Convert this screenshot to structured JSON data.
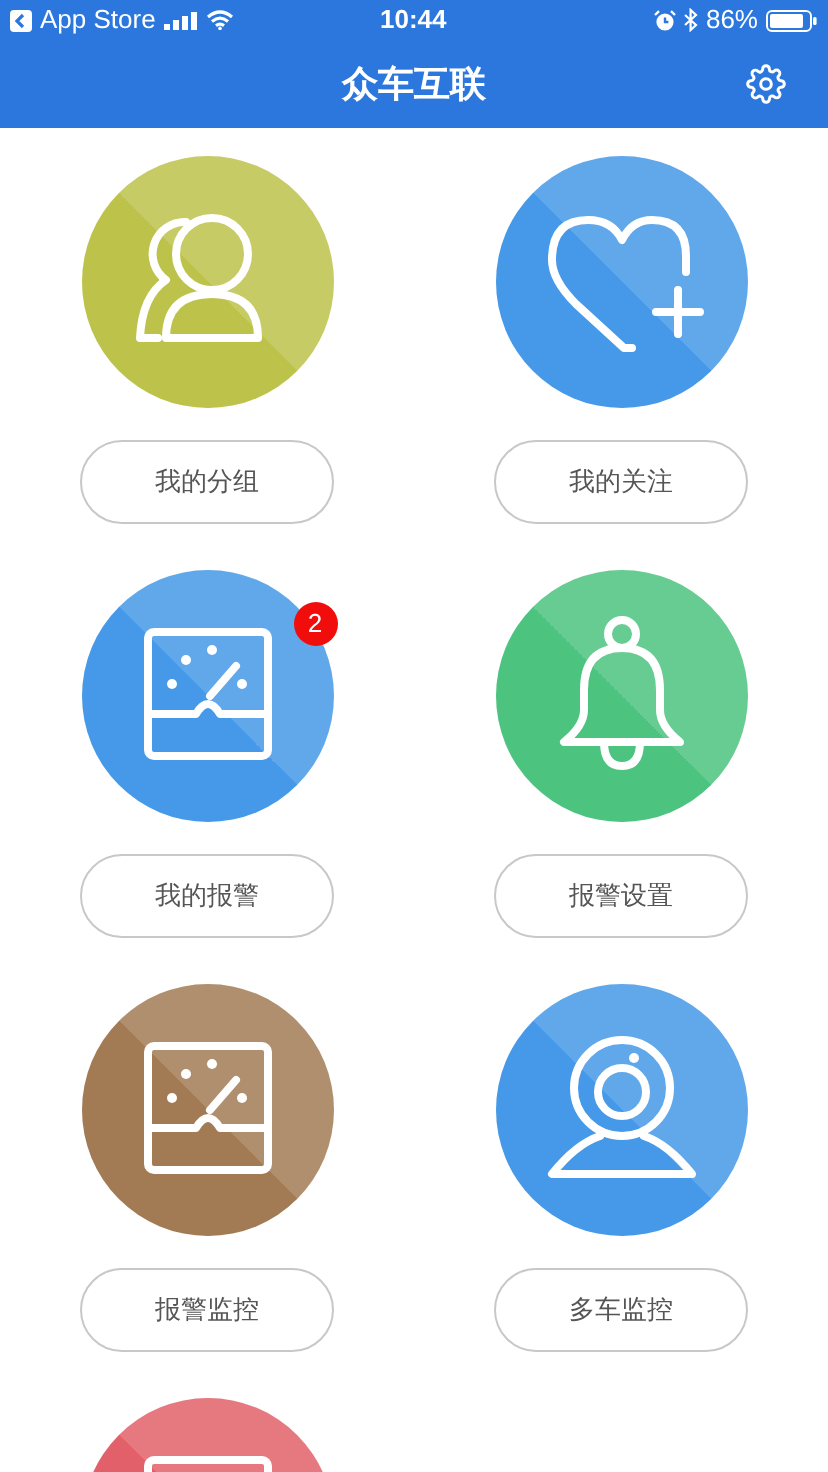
{
  "status_bar": {
    "back_label": "App Store",
    "time": "10:44",
    "battery": "86%"
  },
  "nav_bar": {
    "title": "众车互联"
  },
  "tiles": [
    {
      "kind": "people",
      "color": "#bcc24a",
      "label": "我的分组"
    },
    {
      "kind": "heart",
      "color": "#4599e8",
      "label": "我的关注"
    },
    {
      "kind": "gauge",
      "color": "#4599e8",
      "label": "我的报警",
      "badge": "2"
    },
    {
      "kind": "bell",
      "color": "#4cc37f",
      "label": "报警设置"
    },
    {
      "kind": "gauge",
      "color": "#a27b55",
      "label": "报警监控"
    },
    {
      "kind": "camera",
      "color": "#4599e8",
      "label": "多车监控"
    },
    {
      "kind": "gauge",
      "color": "#e2606a"
    }
  ]
}
